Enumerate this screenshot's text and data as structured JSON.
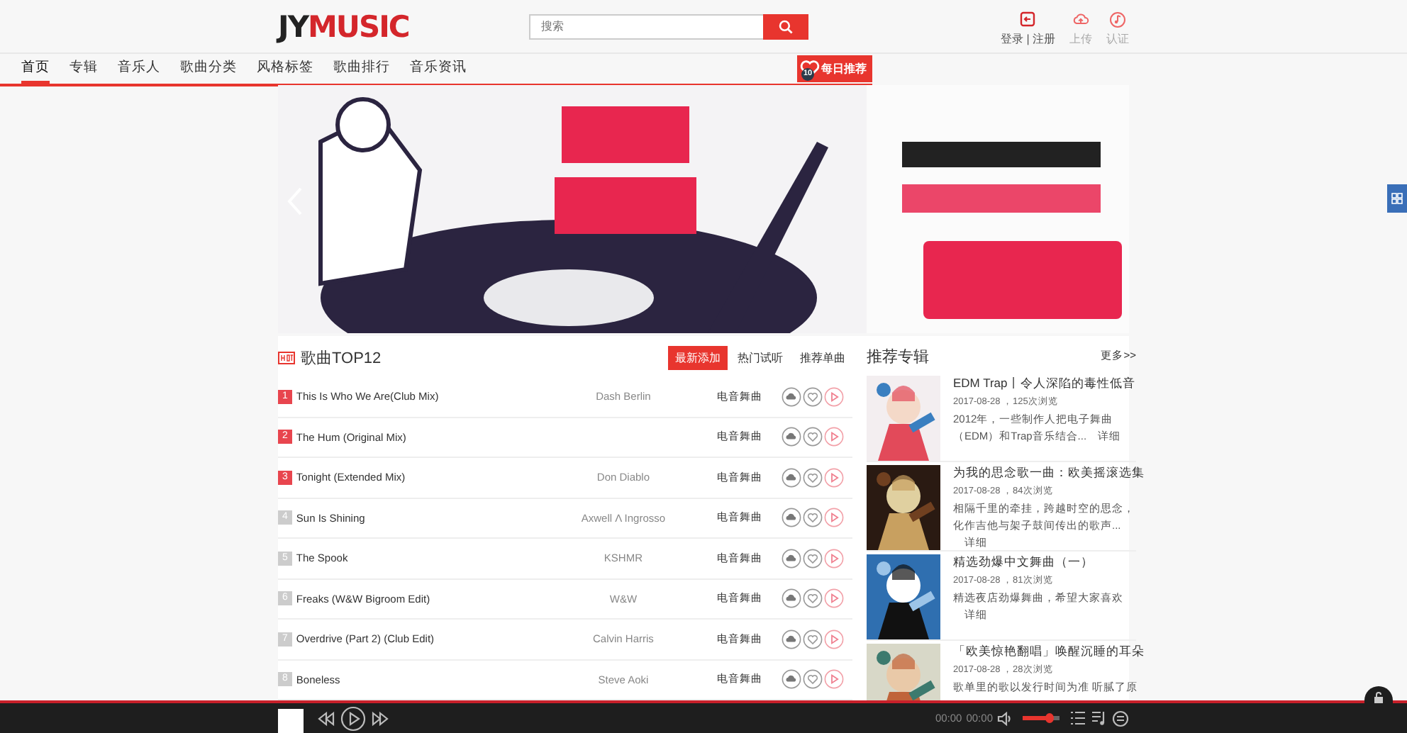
{
  "header": {
    "logo": {
      "dark": "JY",
      "accent": "MUSIC"
    },
    "search": {
      "placeholder": "搜索"
    },
    "user_links": [
      {
        "kind": "login",
        "label": "登录 | 注册"
      },
      {
        "kind": "upload",
        "label": "上传"
      },
      {
        "kind": "verify",
        "label": "认证"
      }
    ]
  },
  "nav": {
    "items": [
      {
        "label": "首页",
        "selected": true
      },
      {
        "label": "专辑",
        "selected": false
      },
      {
        "label": "音乐人",
        "selected": false
      },
      {
        "label": "歌曲分类",
        "selected": false
      },
      {
        "label": "风格标签",
        "selected": false
      },
      {
        "label": "歌曲排行",
        "selected": false
      },
      {
        "label": "音乐资讯",
        "selected": false
      }
    ],
    "daily": {
      "badge": "10",
      "label": "每日推荐"
    }
  },
  "top_songs": {
    "title": "歌曲TOP12",
    "tabs": [
      {
        "label": "最新添加",
        "selected": true
      },
      {
        "label": "热门试听",
        "selected": false
      },
      {
        "label": "推荐单曲",
        "selected": false
      }
    ],
    "rows": [
      {
        "rank": "1",
        "highlighted": true,
        "title": "This Is Who We Are(Club Mix)",
        "artist": "Dash Berlin",
        "genre": "电音舞曲"
      },
      {
        "rank": "2",
        "highlighted": true,
        "title": "The Hum (Original Mix)",
        "genre": "电音舞曲"
      },
      {
        "rank": "3",
        "highlighted": true,
        "title": "Tonight (Extended Mix)",
        "artist": "Don Diablo",
        "genre": "电音舞曲"
      },
      {
        "rank": "4",
        "highlighted": false,
        "title": "Sun Is Shining",
        "artist": "Axwell Λ Ingrosso",
        "genre": "电音舞曲"
      },
      {
        "rank": "5",
        "highlighted": false,
        "title": "The Spook",
        "artist": "KSHMR",
        "genre": "电音舞曲"
      },
      {
        "rank": "6",
        "highlighted": false,
        "title": "Freaks (W&W Bigroom Edit)",
        "artist": "W&W",
        "genre": "电音舞曲"
      },
      {
        "rank": "7",
        "highlighted": false,
        "title": "Overdrive (Part 2) (Club Edit)",
        "artist": "Calvin Harris",
        "genre": "电音舞曲"
      },
      {
        "rank": "8",
        "highlighted": false,
        "title": "Boneless",
        "artist": "Steve Aoki",
        "genre": "电音舞曲"
      }
    ]
  },
  "albums": {
    "title": "推荐专辑",
    "more": "更多>>",
    "items": [
      {
        "title": "EDM Trap丨令人深陷的毒性低音",
        "meta": "2017-08-28 ，125次浏览",
        "desc": "2012年，一些制作人把电子舞曲（EDM）和Trap音乐结合...",
        "detail": "详细"
      },
      {
        "title": "为我的思念歌一曲：欧美摇滚选集",
        "meta": "2017-08-28 ，84次浏览",
        "desc": "相隔千里的牵挂，跨越时空的思念，化作吉他与架子鼓间传出的歌声...",
        "detail": "详细"
      },
      {
        "title": "精选劲爆中文舞曲（一）",
        "meta": "2017-08-28 ，81次浏览",
        "desc": "精选夜店劲爆舞曲，希望大家喜欢",
        "detail": "详细"
      },
      {
        "title": "「欧美惊艳翻唱」唤醒沉睡的耳朵",
        "meta": "2017-08-28 ，28次浏览",
        "desc": "歌单里的歌以发行时间为准 听腻了原"
      }
    ]
  },
  "player": {
    "elapsed": "00:00",
    "duration": "00:00",
    "volume": {
      "level": 0.72
    }
  }
}
